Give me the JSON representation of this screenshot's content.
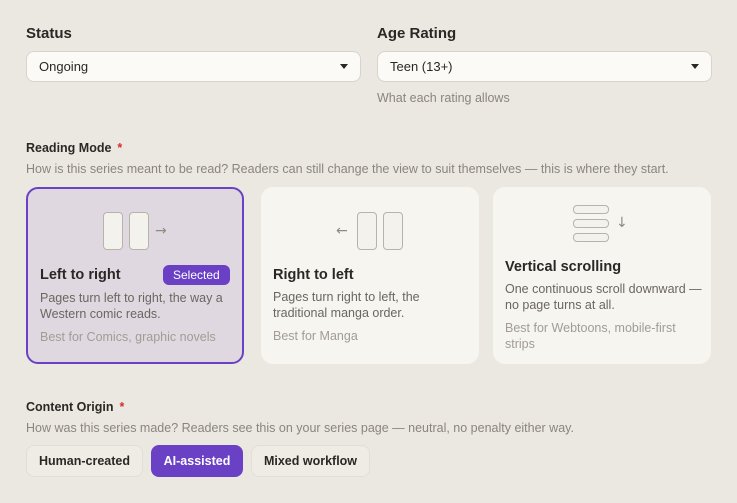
{
  "status": {
    "label": "Status",
    "value": "Ongoing"
  },
  "age_rating": {
    "label": "Age Rating",
    "value": "Teen (13+)",
    "help_link": "What each rating allows"
  },
  "reading_mode": {
    "title": "Reading Mode",
    "required_mark": "*",
    "help": "How is this series meant to be read? Readers can still change the view to suit themselves — this is where they start.",
    "cards": [
      {
        "title": "Left to right",
        "badge": "Selected",
        "desc": "Pages turn left to right, the way a Western comic reads.",
        "best": "Best for Comics, graphic novels",
        "selected": true
      },
      {
        "title": "Right to left",
        "desc": "Pages turn right to left, the traditional manga order.",
        "best": "Best for Manga",
        "selected": false
      },
      {
        "title": "Vertical scrolling",
        "desc": "One continuous scroll downward — no page turns at all.",
        "best": "Best for Webtoons, mobile-first strips",
        "selected": false
      }
    ],
    "icons": {
      "arrow_right": "→",
      "arrow_left": "←",
      "arrow_down": "↓"
    }
  },
  "content_origin": {
    "title": "Content Origin",
    "required_mark": "*",
    "help": "How was this series made? Readers see this on your series page — neutral, no penalty either way.",
    "options": [
      "Human-created",
      "AI-assisted",
      "Mixed workflow"
    ],
    "selected": "AI-assisted"
  },
  "colors": {
    "accent": "#6a40c4",
    "background": "#ebe8e2",
    "required": "#d32f2f"
  }
}
